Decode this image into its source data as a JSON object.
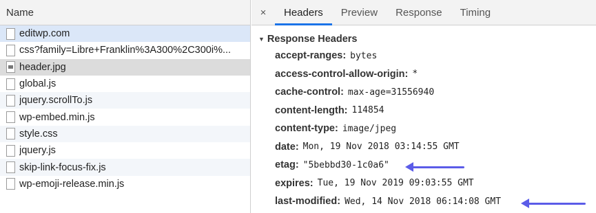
{
  "file_list": {
    "column_header": "Name",
    "files": [
      {
        "name": "editwp.com",
        "icon": "document-icon"
      },
      {
        "name": "css?family=Libre+Franklin%3A300%2C300i%...",
        "icon": "document-icon"
      },
      {
        "name": "header.jpg",
        "icon": "image-icon"
      },
      {
        "name": "global.js",
        "icon": "document-icon"
      },
      {
        "name": "jquery.scrollTo.js",
        "icon": "document-icon"
      },
      {
        "name": "wp-embed.min.js",
        "icon": "document-icon"
      },
      {
        "name": "style.css",
        "icon": "document-icon"
      },
      {
        "name": "jquery.js",
        "icon": "document-icon"
      },
      {
        "name": "skip-link-focus-fix.js",
        "icon": "document-icon"
      },
      {
        "name": "wp-emoji-release.min.js",
        "icon": "document-icon"
      }
    ]
  },
  "details": {
    "close_label": "×",
    "tabs": [
      {
        "label": "Headers",
        "active": true
      },
      {
        "label": "Preview",
        "active": false
      },
      {
        "label": "Response",
        "active": false
      },
      {
        "label": "Timing",
        "active": false
      }
    ],
    "section_title": "Response Headers",
    "section_toggle": "▼",
    "headers": [
      {
        "key": "accept-ranges:",
        "value": "bytes"
      },
      {
        "key": "access-control-allow-origin:",
        "value": "*"
      },
      {
        "key": "cache-control:",
        "value": "max-age=31556940"
      },
      {
        "key": "content-length:",
        "value": "114854"
      },
      {
        "key": "content-type:",
        "value": "image/jpeg"
      },
      {
        "key": "date:",
        "value": "Mon, 19 Nov 2018 03:14:55 GMT"
      },
      {
        "key": "etag:",
        "value": "\"5bebbd30-1c0a6\""
      },
      {
        "key": "expires:",
        "value": "Tue, 19 Nov 2019 09:03:55 GMT"
      },
      {
        "key": "last-modified:",
        "value": "Wed, 14 Nov 2018 06:14:08 GMT"
      }
    ]
  },
  "colors": {
    "accent": "#1a73e8",
    "annotation_arrow": "#5b5ce8",
    "selected_row": "#dbe7f8",
    "active_row": "#dcdcdc"
  }
}
